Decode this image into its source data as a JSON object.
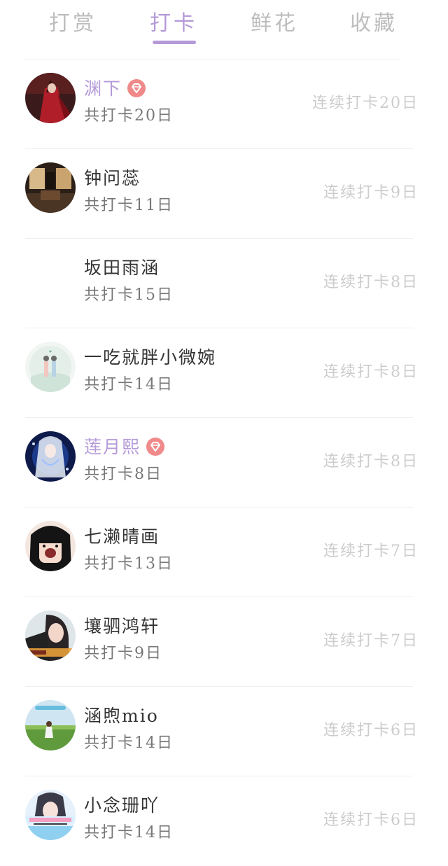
{
  "tabs": [
    {
      "label": "打赏",
      "active": false
    },
    {
      "label": "打卡",
      "active": true
    },
    {
      "label": "鲜花",
      "active": false
    },
    {
      "label": "收藏",
      "active": false
    }
  ],
  "colors": {
    "accent": "#b59ad8",
    "vip_badge": "#f08a8a",
    "tab_inactive": "#bdbdbd",
    "streak_text": "#cccccc"
  },
  "entries": [
    {
      "name": "渊下",
      "vip": true,
      "total": "共打卡20日",
      "streak": "连续打卡20日",
      "avatar": "avatar-red-dress"
    },
    {
      "name": "钟问蕊",
      "vip": false,
      "total": "共打卡11日",
      "streak": "连续打卡9日",
      "avatar": "avatar-dark-room"
    },
    {
      "name": "坂田雨涵",
      "vip": false,
      "total": "共打卡15日",
      "streak": "连续打卡8日",
      "avatar": "avatar-blank"
    },
    {
      "name": "一吃就胖小微婉",
      "vip": false,
      "total": "共打卡14日",
      "streak": "连续打卡8日",
      "avatar": "avatar-couple-illustration"
    },
    {
      "name": "莲月熙",
      "vip": true,
      "total": "共打卡8日",
      "streak": "连续打卡8日",
      "avatar": "avatar-blue-anime"
    },
    {
      "name": "七濑晴画",
      "vip": false,
      "total": "共打卡13日",
      "streak": "连续打卡7日",
      "avatar": "avatar-black-hair-cartoon"
    },
    {
      "name": "壤驷鸿轩",
      "vip": false,
      "total": "共打卡9日",
      "streak": "连续打卡7日",
      "avatar": "avatar-girl-photo"
    },
    {
      "name": "涵煦mio",
      "vip": false,
      "total": "共打卡14日",
      "streak": "连续打卡6日",
      "avatar": "avatar-field-photo"
    },
    {
      "name": "小念珊吖",
      "vip": false,
      "total": "共打卡14日",
      "streak": "连续打卡6日",
      "avatar": "avatar-pastel-photo"
    }
  ]
}
